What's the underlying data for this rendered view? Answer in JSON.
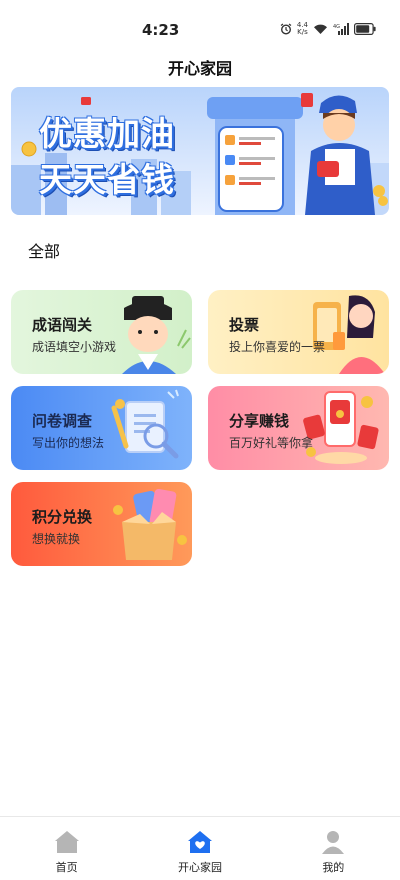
{
  "status": {
    "time": "4:23",
    "net_speed_top": "4.4",
    "net_speed_bottom": "K/s",
    "battery_level": 0.85
  },
  "header": {
    "title": "开心家园"
  },
  "banner": {
    "line1": "优惠加油",
    "line2": "天天省钱"
  },
  "section": {
    "title": "全部"
  },
  "cards": [
    {
      "title": "成语闯关",
      "subtitle": "成语填空小游戏"
    },
    {
      "title": "投票",
      "subtitle": "投上你喜爱的一票"
    },
    {
      "title": "问卷调查",
      "subtitle": "写出你的想法"
    },
    {
      "title": "分享赚钱",
      "subtitle": "百万好礼等你拿"
    },
    {
      "title": "积分兑换",
      "subtitle": "想换就换"
    }
  ],
  "tabs": [
    {
      "label": "首页",
      "icon": "house-icon",
      "active": false
    },
    {
      "label": "开心家园",
      "icon": "heart-house-icon",
      "active": true
    },
    {
      "label": "我的",
      "icon": "person-icon",
      "active": false
    }
  ],
  "colors": {
    "active_tab": "#1e6ff0",
    "inactive_tab": "#b5b5b5"
  }
}
